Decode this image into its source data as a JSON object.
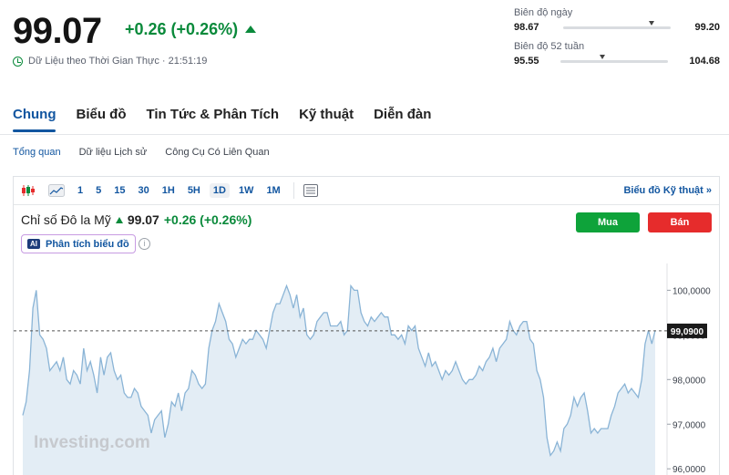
{
  "quote": {
    "price": "99.07",
    "change": "+0.26 (+0.26%)",
    "realtime_label": "Dữ Liệu theo Thời Gian Thực · 21:51:19"
  },
  "day_range": {
    "label": "Biên độ ngày",
    "low": "98.67",
    "high": "99.20",
    "position": 0.82
  },
  "week52_range": {
    "label": "Biên độ 52 tuần",
    "low": "95.55",
    "high": "104.68",
    "position": 0.39
  },
  "tabs": [
    {
      "label": "Chung",
      "active": true
    },
    {
      "label": "Biểu đồ",
      "active": false
    },
    {
      "label": "Tin Tức & Phân Tích",
      "active": false
    },
    {
      "label": "Kỹ thuật",
      "active": false
    },
    {
      "label": "Diễn đàn",
      "active": false
    }
  ],
  "subtabs": [
    {
      "label": "Tổng quan",
      "active": true
    },
    {
      "label": "Dữ liệu Lịch sử",
      "active": false
    },
    {
      "label": "Công Cụ Có Liên Quan",
      "active": false
    }
  ],
  "toolbar": {
    "timeframes": [
      "1",
      "5",
      "15",
      "30",
      "1H",
      "5H",
      "1D",
      "1W",
      "1M"
    ],
    "selected": "1D",
    "tech_chart_link": "Biểu đồ Kỹ thuật »"
  },
  "instrument": {
    "name": "Chỉ số Đô la Mỹ",
    "price": "99.07",
    "change": "+0.26 (+0.26%)"
  },
  "ai_button": {
    "badge": "AI",
    "label": "Phân tích biểu đồ"
  },
  "info_icon_glyph": "i",
  "buy_label": "Mua",
  "sell_label": "Bán",
  "colors": {
    "up": "#0a8a3b",
    "buy": "#0ea33a",
    "sell": "#e62c2c",
    "link": "#1256a0",
    "line": "#8ab4d6",
    "fill": "#e3edf5"
  },
  "chart_data": {
    "type": "area",
    "y_ticks": [
      "100,0000",
      "99,0000",
      "98,0000",
      "97,0000",
      "96,0000"
    ],
    "ylim": [
      95.8,
      100.6
    ],
    "current_label": "99,0900",
    "current_value": 99.09,
    "watermark": "Investing.com",
    "values": [
      97.2,
      97.5,
      98.2,
      99.6,
      100.0,
      99.0,
      98.9,
      98.7,
      98.2,
      98.3,
      98.4,
      98.2,
      98.5,
      98.0,
      97.9,
      98.2,
      98.1,
      97.9,
      98.7,
      98.2,
      98.4,
      98.1,
      97.7,
      98.5,
      98.1,
      98.5,
      98.6,
      98.2,
      98.0,
      98.1,
      97.7,
      97.6,
      97.6,
      97.8,
      97.7,
      97.4,
      97.3,
      97.2,
      96.8,
      97.1,
      97.2,
      97.3,
      96.7,
      97.0,
      97.5,
      97.4,
      97.7,
      97.3,
      97.7,
      97.8,
      98.2,
      98.1,
      97.9,
      97.8,
      97.9,
      98.7,
      99.1,
      99.3,
      99.7,
      99.5,
      99.3,
      98.9,
      98.8,
      98.5,
      98.7,
      98.9,
      98.8,
      98.9,
      98.9,
      99.1,
      99.0,
      98.9,
      98.7,
      99.1,
      99.5,
      99.7,
      99.7,
      99.9,
      100.1,
      99.9,
      99.6,
      99.9,
      99.4,
      99.6,
      99.0,
      98.9,
      99.0,
      99.3,
      99.4,
      99.5,
      99.5,
      99.2,
      99.2,
      99.2,
      99.3,
      99.0,
      99.1,
      100.1,
      100.0,
      100.0,
      99.5,
      99.3,
      99.2,
      99.4,
      99.3,
      99.4,
      99.5,
      99.4,
      99.4,
      99.0,
      99.0,
      98.9,
      99.0,
      98.8,
      99.2,
      99.1,
      99.2,
      98.7,
      98.5,
      98.3,
      98.6,
      98.3,
      98.4,
      98.2,
      98.0,
      98.2,
      98.1,
      98.2,
      98.4,
      98.2,
      98.0,
      97.9,
      98.0,
      98.0,
      98.1,
      98.3,
      98.2,
      98.4,
      98.5,
      98.7,
      98.4,
      98.7,
      98.8,
      98.9,
      99.3,
      99.1,
      99.0,
      99.2,
      99.3,
      99.3,
      98.9,
      98.8,
      98.2,
      98.0,
      97.6,
      96.7,
      96.3,
      96.4,
      96.6,
      96.4,
      96.9,
      97.0,
      97.2,
      97.6,
      97.4,
      97.6,
      97.7,
      97.3,
      96.8,
      96.9,
      96.8,
      96.9,
      96.9,
      96.9,
      97.2,
      97.4,
      97.7,
      97.8,
      97.9,
      97.7,
      97.8,
      97.7,
      97.6,
      98.0,
      98.8,
      99.1,
      98.8,
      99.1
    ]
  }
}
